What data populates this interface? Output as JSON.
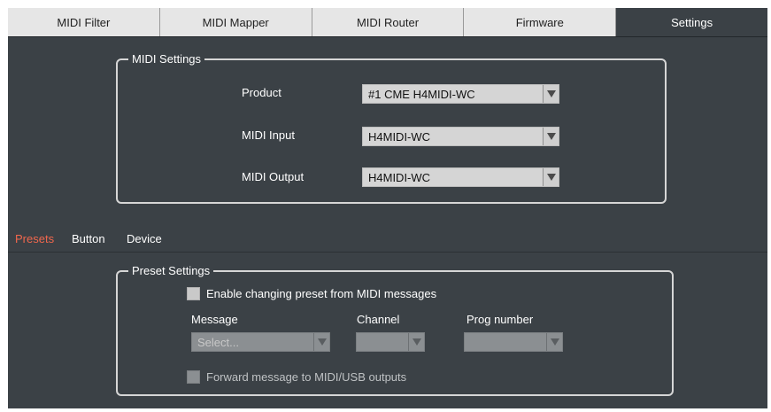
{
  "tabs": [
    {
      "label": "MIDI Filter"
    },
    {
      "label": "MIDI Mapper"
    },
    {
      "label": "MIDI Router"
    },
    {
      "label": "Firmware"
    },
    {
      "label": "Settings"
    }
  ],
  "midi_settings": {
    "title": "MIDI Settings",
    "product": {
      "label": "Product",
      "value": "#1 CME H4MIDI-WC"
    },
    "input": {
      "label": "MIDI Input",
      "value": "H4MIDI-WC"
    },
    "output": {
      "label": "MIDI Output",
      "value": "H4MIDI-WC"
    }
  },
  "subtabs": [
    {
      "label": "Presets"
    },
    {
      "label": "Button"
    },
    {
      "label": "Device"
    }
  ],
  "preset_settings": {
    "title": "Preset Settings",
    "enable_label": "Enable changing preset from MIDI messages",
    "message_label": "Message",
    "channel_label": "Channel",
    "prog_label": "Prog number",
    "message_placeholder": "Select...",
    "channel_value": "",
    "prog_value": "",
    "forward_label": "Forward message to MIDI/USB outputs"
  },
  "colors": {
    "background": "#3b4146",
    "active_subtab": "#f0674d",
    "inactive_tab": "#e6e6e6"
  }
}
